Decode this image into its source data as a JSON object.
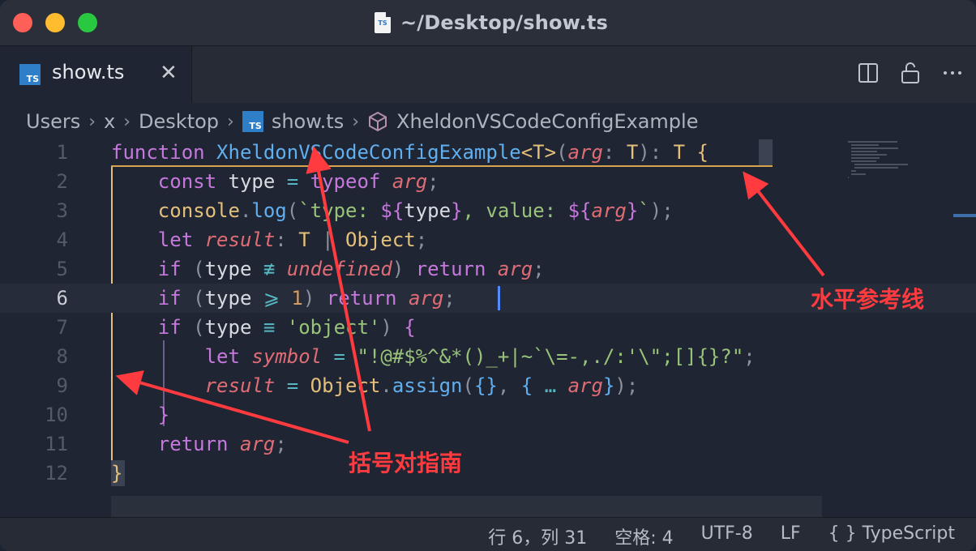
{
  "window": {
    "title": "~/Desktop/show.ts",
    "file_icon_text": "TS"
  },
  "tab": {
    "label": "show.ts",
    "close": "✕",
    "badge": "TS"
  },
  "breadcrumb": {
    "items": [
      "Users",
      "x",
      "Desktop",
      "show.ts",
      "XheldonVSCodeConfigExample"
    ],
    "separator": "›"
  },
  "editor": {
    "line_numbers": [
      "1",
      "2",
      "3",
      "4",
      "5",
      "6",
      "7",
      "8",
      "9",
      "10",
      "11",
      "12"
    ],
    "current_line": "6",
    "lines": [
      [
        [
          "kw",
          "function "
        ],
        [
          "fn",
          "XheldonVSCodeConfigExample"
        ],
        [
          "ty",
          "<T>"
        ],
        [
          "gy",
          "("
        ],
        [
          "pm",
          "arg"
        ],
        [
          "gy",
          ": "
        ],
        [
          "ty",
          "T"
        ],
        [
          "gy",
          "): "
        ],
        [
          "ty",
          "T"
        ],
        [
          "gy",
          " "
        ],
        [
          "ty",
          "{"
        ]
      ],
      [
        [
          "gy",
          "    "
        ],
        [
          "kw",
          "const "
        ],
        [
          "vr",
          "type "
        ],
        [
          "op",
          "= "
        ],
        [
          "kw",
          "typeof "
        ],
        [
          "pm",
          "arg"
        ],
        [
          "gy",
          ";"
        ]
      ],
      [
        [
          "gy",
          "    "
        ],
        [
          "ty",
          "console"
        ],
        [
          "gy",
          "."
        ],
        [
          "fn",
          "log"
        ],
        [
          "gy",
          "("
        ],
        [
          "st",
          "`type: "
        ],
        [
          "kw",
          "${"
        ],
        [
          "vr",
          "type"
        ],
        [
          "kw",
          "}"
        ],
        [
          "st",
          ", value: "
        ],
        [
          "kw",
          "${"
        ],
        [
          "pm",
          "arg"
        ],
        [
          "kw",
          "}"
        ],
        [
          "st",
          "`"
        ],
        [
          "gy",
          ");"
        ]
      ],
      [
        [
          "gy",
          "    "
        ],
        [
          "kw",
          "let "
        ],
        [
          "pm",
          "result"
        ],
        [
          "gy",
          ": "
        ],
        [
          "ty",
          "T "
        ],
        [
          "gy",
          "| "
        ],
        [
          "ty",
          "Object"
        ],
        [
          "gy",
          ";"
        ]
      ],
      [
        [
          "gy",
          "    "
        ],
        [
          "kw",
          "if "
        ],
        [
          "gy",
          "("
        ],
        [
          "vr",
          "type "
        ],
        [
          "op",
          "≢ "
        ],
        [
          "pm",
          "undefined"
        ],
        [
          "gy",
          ") "
        ],
        [
          "kw",
          "return "
        ],
        [
          "pm",
          "arg"
        ],
        [
          "gy",
          ";"
        ]
      ],
      [
        [
          "gy",
          "    "
        ],
        [
          "kw",
          "if "
        ],
        [
          "gy",
          "("
        ],
        [
          "vr",
          "type "
        ],
        [
          "op",
          "⩾ "
        ],
        [
          "num",
          "1"
        ],
        [
          "gy",
          ") "
        ],
        [
          "kw",
          "return "
        ],
        [
          "pm",
          "arg"
        ],
        [
          "gy",
          ";"
        ]
      ],
      [
        [
          "gy",
          "    "
        ],
        [
          "kw",
          "if "
        ],
        [
          "gy",
          "("
        ],
        [
          "vr",
          "type "
        ],
        [
          "op",
          "≡ "
        ],
        [
          "st",
          "'object'"
        ],
        [
          "gy",
          ") "
        ],
        [
          "kw",
          "{"
        ]
      ],
      [
        [
          "gy",
          "        "
        ],
        [
          "kw",
          "let "
        ],
        [
          "pm",
          "symbol "
        ],
        [
          "op",
          "= "
        ],
        [
          "st",
          "\"!@#$%^&*()_+|~`\\=-,./:'\\\";[]{}?\""
        ],
        [
          "gy",
          ";"
        ]
      ],
      [
        [
          "gy",
          "        "
        ],
        [
          "pm",
          "result "
        ],
        [
          "op",
          "= "
        ],
        [
          "ty",
          "Object"
        ],
        [
          "gy",
          "."
        ],
        [
          "fn",
          "assign"
        ],
        [
          "gy",
          "("
        ],
        [
          "bl",
          "{}"
        ],
        [
          "gy",
          ", "
        ],
        [
          "bl",
          "{ "
        ],
        [
          "op",
          "… "
        ],
        [
          "pm",
          "arg"
        ],
        [
          "bl",
          "}"
        ],
        [
          "gy",
          ");"
        ]
      ],
      [
        [
          "gy",
          "    "
        ],
        [
          "kw",
          "}"
        ]
      ],
      [
        [
          "gy",
          "    "
        ],
        [
          "kw",
          "return "
        ],
        [
          "pm",
          "arg"
        ],
        [
          "gy",
          ";"
        ]
      ],
      [
        [
          "ty",
          "}"
        ]
      ]
    ]
  },
  "status": {
    "position": "行 6，列 31",
    "indent": "空格: 4",
    "encoding": "UTF-8",
    "eol": "LF",
    "language": "{ } TypeScript"
  },
  "annotations": {
    "horizontal_guide": "水平参考线",
    "bracket_guide": "括号对指南"
  },
  "colors": {
    "accent_annotation": "#ff3b3f",
    "keyword": "#c678dd",
    "function": "#61afef",
    "type": "#e5c07b",
    "string": "#98c379"
  }
}
